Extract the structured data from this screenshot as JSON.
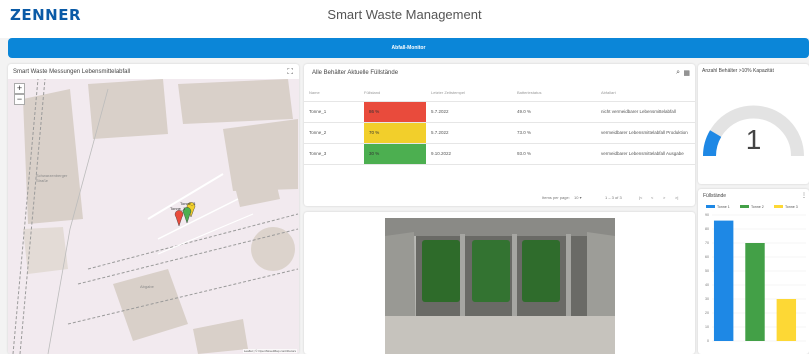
{
  "header": {
    "logo": "ZENNER",
    "title": "Smart Waste Management"
  },
  "banner": {
    "title": "Abfall-Monitor"
  },
  "map_panel": {
    "title": "Smart Waste Messungen Lebensmittelabfall",
    "zoom_in": "+",
    "zoom_out": "−",
    "marker_labels": [
      "Tonne_3",
      "Tonne_1"
    ],
    "street_label": "Schwarzenberger Straße",
    "building_label": "Abgabe",
    "attribution": "Leaflet | © OpenStreetMap contributors"
  },
  "table_panel": {
    "title": "Alle Behälter Aktuelle Füllstände",
    "columns": [
      "Name",
      "Füllstand",
      "Letzter Zeitstempel",
      "Batteriestatus",
      "Abfallart"
    ],
    "rows": [
      {
        "name": "Tonne_1",
        "fill": "86 %",
        "fill_color": "#e94b3c",
        "timestamp": "5.7.2022",
        "battery": "49.0 %",
        "type": "nicht vermeidbarer Lebensmittelabfall"
      },
      {
        "name": "Tonne_2",
        "fill": "70 %",
        "fill_color": "#f2cf2b",
        "timestamp": "5.7.2022",
        "battery": "73.0 %",
        "type": "vermeidbarer Lebensmittelabfall Produktion"
      },
      {
        "name": "Tonne_3",
        "fill": "30 %",
        "fill_color": "#4caf50",
        "timestamp": "9.10.2022",
        "battery": "93.0 %",
        "type": "vermeidbarer Lebensmittelabfall Ausgabe"
      }
    ],
    "search_icon": "search-icon",
    "columns_icon": "columns-icon",
    "rows_per_page_label": "Items per page:",
    "rows_per_page_value": "10",
    "range_label": "1 – 3 of 3",
    "nav_first": "|<",
    "nav_prev": "<",
    "nav_next": ">",
    "nav_last": ">|"
  },
  "gauge_panel": {
    "title": "Anzahl Behälter >10% Kapazität",
    "value": "1",
    "fraction": 0.17,
    "color": "#1e88e5"
  },
  "chart_panel": {
    "title": "Füllstände",
    "menu_icon": "more-icon"
  },
  "chart_data": {
    "type": "bar",
    "categories": [
      "Tonne 1",
      "Tonne 2",
      "Tonne 3"
    ],
    "series": [
      {
        "name": "Tonne 1",
        "values": [
          86,
          0,
          0
        ],
        "color": "#1e88e5"
      },
      {
        "name": "Tonne 2",
        "values": [
          0,
          70,
          0
        ],
        "color": "#43a047"
      },
      {
        "name": "Tonne 3",
        "values": [
          0,
          0,
          30
        ],
        "color": "#fdd835"
      }
    ],
    "values": [
      86,
      70,
      30
    ],
    "colors": [
      "#1e88e5",
      "#43a047",
      "#fdd835"
    ],
    "ylim": [
      0,
      90
    ],
    "yticks": [
      "0",
      "10",
      "20",
      "30",
      "40",
      "50",
      "60",
      "70",
      "80",
      "90"
    ],
    "title": "Füllstände",
    "legend": "top"
  }
}
